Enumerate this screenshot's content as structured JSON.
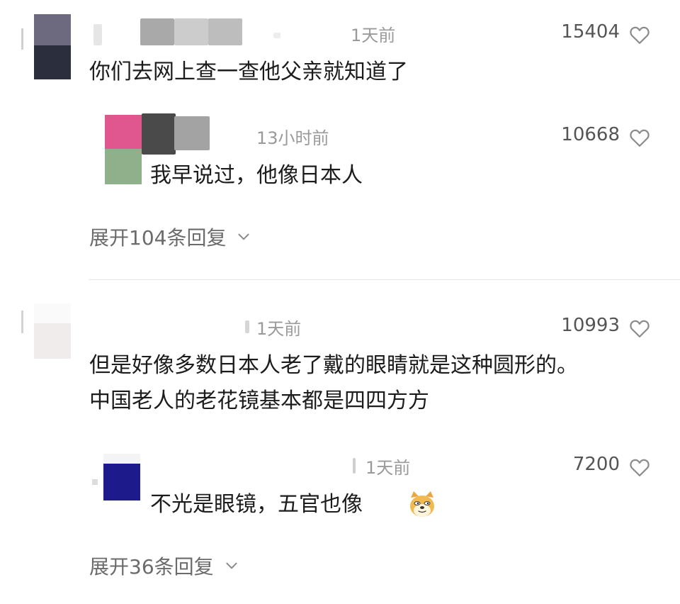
{
  "comments": [
    {
      "id": "c1",
      "time": "1天前",
      "likes": "15404",
      "text": "你们去网上查一查他父亲就知道了",
      "replies": [
        {
          "id": "r1",
          "time": "13小时前",
          "likes": "10668",
          "text": "我早说过，他像日本人"
        }
      ],
      "expand_label": "展开104条回复"
    },
    {
      "id": "c2",
      "time": "1天前",
      "likes": "10993",
      "text_lines": [
        "但是好像多数日本人老了戴的眼睛就是这种圆形的。",
        "中国老人的老花镜基本都是四四方方"
      ],
      "replies": [
        {
          "id": "r2",
          "time": "1天前",
          "likes": "7200",
          "text": "不光是眼镜，五官也像",
          "emoji": "doge-emoji"
        }
      ],
      "expand_label": "展开36条回复"
    }
  ],
  "icons": {
    "like": "heart-outline-icon",
    "expand": "chevron-down-icon"
  },
  "colors": {
    "meta_text": "#9a9a9a",
    "likes_text": "#555555",
    "body_text": "#1c1c1c",
    "expand_text": "#6b6b6b",
    "divider": "#e6e6e6"
  }
}
